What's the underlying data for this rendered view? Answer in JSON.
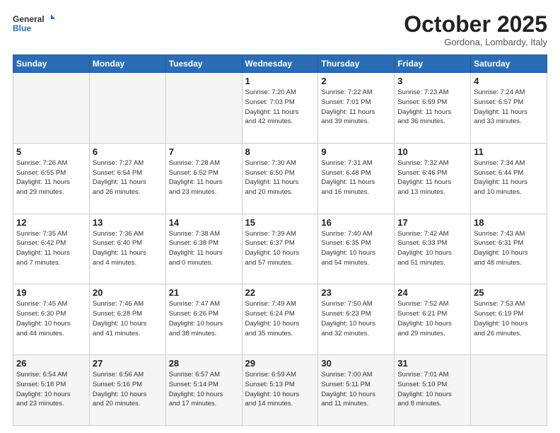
{
  "header": {
    "logo_general": "General",
    "logo_blue": "Blue",
    "month_title": "October 2025",
    "location": "Gordona, Lombardy, Italy"
  },
  "days_of_week": [
    "Sunday",
    "Monday",
    "Tuesday",
    "Wednesday",
    "Thursday",
    "Friday",
    "Saturday"
  ],
  "weeks": [
    [
      {
        "day": "",
        "info": ""
      },
      {
        "day": "",
        "info": ""
      },
      {
        "day": "",
        "info": ""
      },
      {
        "day": "1",
        "info": "Sunrise: 7:20 AM\nSunset: 7:03 PM\nDaylight: 11 hours\nand 42 minutes."
      },
      {
        "day": "2",
        "info": "Sunrise: 7:22 AM\nSunset: 7:01 PM\nDaylight: 11 hours\nand 39 minutes."
      },
      {
        "day": "3",
        "info": "Sunrise: 7:23 AM\nSunset: 6:59 PM\nDaylight: 11 hours\nand 36 minutes."
      },
      {
        "day": "4",
        "info": "Sunrise: 7:24 AM\nSunset: 6:57 PM\nDaylight: 11 hours\nand 33 minutes."
      }
    ],
    [
      {
        "day": "5",
        "info": "Sunrise: 7:26 AM\nSunset: 6:55 PM\nDaylight: 11 hours\nand 29 minutes."
      },
      {
        "day": "6",
        "info": "Sunrise: 7:27 AM\nSunset: 6:54 PM\nDaylight: 11 hours\nand 26 minutes."
      },
      {
        "day": "7",
        "info": "Sunrise: 7:28 AM\nSunset: 6:52 PM\nDaylight: 11 hours\nand 23 minutes."
      },
      {
        "day": "8",
        "info": "Sunrise: 7:30 AM\nSunset: 6:50 PM\nDaylight: 11 hours\nand 20 minutes."
      },
      {
        "day": "9",
        "info": "Sunrise: 7:31 AM\nSunset: 6:48 PM\nDaylight: 11 hours\nand 16 minutes."
      },
      {
        "day": "10",
        "info": "Sunrise: 7:32 AM\nSunset: 6:46 PM\nDaylight: 11 hours\nand 13 minutes."
      },
      {
        "day": "11",
        "info": "Sunrise: 7:34 AM\nSunset: 6:44 PM\nDaylight: 11 hours\nand 10 minutes."
      }
    ],
    [
      {
        "day": "12",
        "info": "Sunrise: 7:35 AM\nSunset: 6:42 PM\nDaylight: 11 hours\nand 7 minutes."
      },
      {
        "day": "13",
        "info": "Sunrise: 7:36 AM\nSunset: 6:40 PM\nDaylight: 11 hours\nand 4 minutes."
      },
      {
        "day": "14",
        "info": "Sunrise: 7:38 AM\nSunset: 6:38 PM\nDaylight: 11 hours\nand 0 minutes."
      },
      {
        "day": "15",
        "info": "Sunrise: 7:39 AM\nSunset: 6:37 PM\nDaylight: 10 hours\nand 57 minutes."
      },
      {
        "day": "16",
        "info": "Sunrise: 7:40 AM\nSunset: 6:35 PM\nDaylight: 10 hours\nand 54 minutes."
      },
      {
        "day": "17",
        "info": "Sunrise: 7:42 AM\nSunset: 6:33 PM\nDaylight: 10 hours\nand 51 minutes."
      },
      {
        "day": "18",
        "info": "Sunrise: 7:43 AM\nSunset: 6:31 PM\nDaylight: 10 hours\nand 48 minutes."
      }
    ],
    [
      {
        "day": "19",
        "info": "Sunrise: 7:45 AM\nSunset: 6:30 PM\nDaylight: 10 hours\nand 44 minutes."
      },
      {
        "day": "20",
        "info": "Sunrise: 7:46 AM\nSunset: 6:28 PM\nDaylight: 10 hours\nand 41 minutes."
      },
      {
        "day": "21",
        "info": "Sunrise: 7:47 AM\nSunset: 6:26 PM\nDaylight: 10 hours\nand 38 minutes."
      },
      {
        "day": "22",
        "info": "Sunrise: 7:49 AM\nSunset: 6:24 PM\nDaylight: 10 hours\nand 35 minutes."
      },
      {
        "day": "23",
        "info": "Sunrise: 7:50 AM\nSunset: 6:23 PM\nDaylight: 10 hours\nand 32 minutes."
      },
      {
        "day": "24",
        "info": "Sunrise: 7:52 AM\nSunset: 6:21 PM\nDaylight: 10 hours\nand 29 minutes."
      },
      {
        "day": "25",
        "info": "Sunrise: 7:53 AM\nSunset: 6:19 PM\nDaylight: 10 hours\nand 26 minutes."
      }
    ],
    [
      {
        "day": "26",
        "info": "Sunrise: 6:54 AM\nSunset: 5:18 PM\nDaylight: 10 hours\nand 23 minutes."
      },
      {
        "day": "27",
        "info": "Sunrise: 6:56 AM\nSunset: 5:16 PM\nDaylight: 10 hours\nand 20 minutes."
      },
      {
        "day": "28",
        "info": "Sunrise: 6:57 AM\nSunset: 5:14 PM\nDaylight: 10 hours\nand 17 minutes."
      },
      {
        "day": "29",
        "info": "Sunrise: 6:59 AM\nSunset: 5:13 PM\nDaylight: 10 hours\nand 14 minutes."
      },
      {
        "day": "30",
        "info": "Sunrise: 7:00 AM\nSunset: 5:11 PM\nDaylight: 10 hours\nand 11 minutes."
      },
      {
        "day": "31",
        "info": "Sunrise: 7:01 AM\nSunset: 5:10 PM\nDaylight: 10 hours\nand 8 minutes."
      },
      {
        "day": "",
        "info": ""
      }
    ]
  ]
}
